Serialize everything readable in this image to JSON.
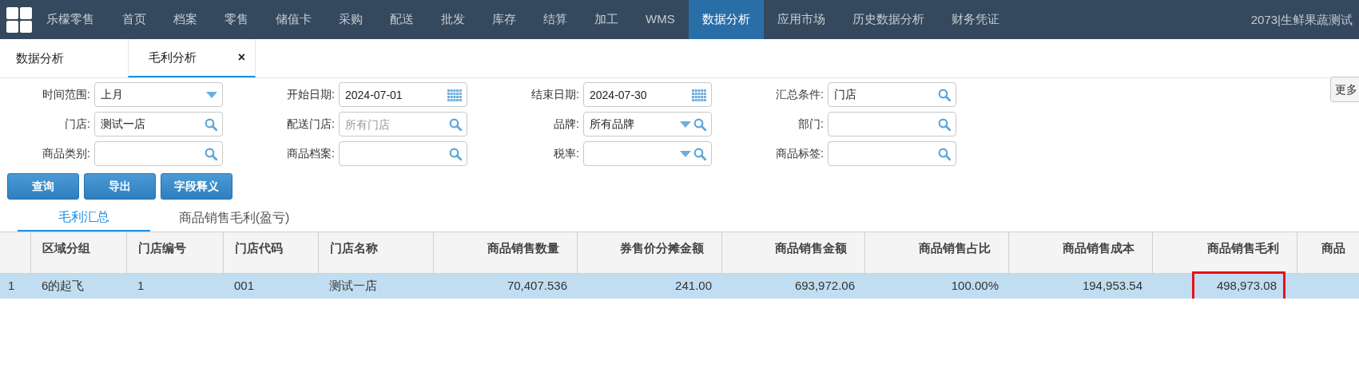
{
  "nav": {
    "brand": "乐檬零售",
    "items": [
      {
        "label": "首页",
        "selected": false
      },
      {
        "label": "档案",
        "selected": false
      },
      {
        "label": "零售",
        "selected": false
      },
      {
        "label": "储值卡",
        "selected": false
      },
      {
        "label": "采购",
        "selected": false
      },
      {
        "label": "配送",
        "selected": false
      },
      {
        "label": "批发",
        "selected": false
      },
      {
        "label": "库存",
        "selected": false
      },
      {
        "label": "结算",
        "selected": false
      },
      {
        "label": "加工",
        "selected": false
      },
      {
        "label": "WMS",
        "selected": false
      },
      {
        "label": "数据分析",
        "selected": true
      },
      {
        "label": "应用市场",
        "selected": false
      },
      {
        "label": "历史数据分析",
        "selected": false
      },
      {
        "label": "财务凭证",
        "selected": false
      }
    ],
    "account": "2073|生鲜果蔬测试"
  },
  "page_tabs": [
    {
      "label": "数据分析",
      "selected": false
    },
    {
      "label": "毛利分析",
      "selected": true,
      "close": "×"
    }
  ],
  "filters": [
    [
      {
        "label": "时间范围:",
        "kind": "select",
        "value": "上月"
      },
      {
        "label": "开始日期:",
        "kind": "date",
        "value": "2024-07-01"
      },
      {
        "label": "结束日期:",
        "kind": "date",
        "value": "2024-07-30"
      },
      {
        "label": "汇总条件:",
        "kind": "lookup",
        "value": "门店"
      }
    ],
    [
      {
        "label": "门店:",
        "kind": "lookup",
        "value": "测试一店"
      },
      {
        "label": "配送门店:",
        "kind": "lookup",
        "placeholder": "所有门店"
      },
      {
        "label": "品牌:",
        "kind": "select-lookup",
        "value": "所有品牌"
      },
      {
        "label": "部门:",
        "kind": "lookup"
      }
    ],
    [
      {
        "label": "商品类别:",
        "kind": "lookup"
      },
      {
        "label": "商品档案:",
        "kind": "lookup"
      },
      {
        "label": "税率:",
        "kind": "select-lookup"
      },
      {
        "label": "商品标签:",
        "kind": "lookup"
      }
    ]
  ],
  "more_button": "更多",
  "buttons": [
    "查询",
    "导出",
    "字段释义"
  ],
  "sub_tabs": [
    {
      "label": "毛利汇总",
      "selected": true
    },
    {
      "label": "商品销售毛利(盈亏)",
      "selected": false
    }
  ],
  "table": {
    "columns": [
      {
        "label": "区域分组",
        "kind": "text"
      },
      {
        "label": "门店编号",
        "kind": "text"
      },
      {
        "label": "门店代码",
        "kind": "text"
      },
      {
        "label": "门店名称",
        "kind": "text"
      },
      {
        "label": "商品销售数量",
        "kind": "number"
      },
      {
        "label": "券售价分摊金额",
        "kind": "number"
      },
      {
        "label": "商品销售金额",
        "kind": "number"
      },
      {
        "label": "商品销售占比",
        "kind": "number"
      },
      {
        "label": "商品销售成本",
        "kind": "number"
      },
      {
        "label": "商品销售毛利",
        "kind": "number"
      },
      {
        "label": "商品",
        "kind": "text"
      }
    ],
    "rows": [
      {
        "index": "1",
        "selected": true,
        "cells": [
          {
            "text": "6的起飞",
            "outlined": false
          },
          {
            "text": "1",
            "outlined": false
          },
          {
            "text": "001",
            "outlined": false
          },
          {
            "text": "测试一店",
            "outlined": false
          },
          {
            "text": "70,407.536",
            "outlined": false
          },
          {
            "text": "241.00",
            "outlined": false
          },
          {
            "text": "693,972.06",
            "outlined": false
          },
          {
            "text": "100.00%",
            "outlined": false
          },
          {
            "text": "194,953.54",
            "outlined": false
          },
          {
            "text": "498,973.08",
            "outlined": true
          }
        ]
      }
    ]
  }
}
